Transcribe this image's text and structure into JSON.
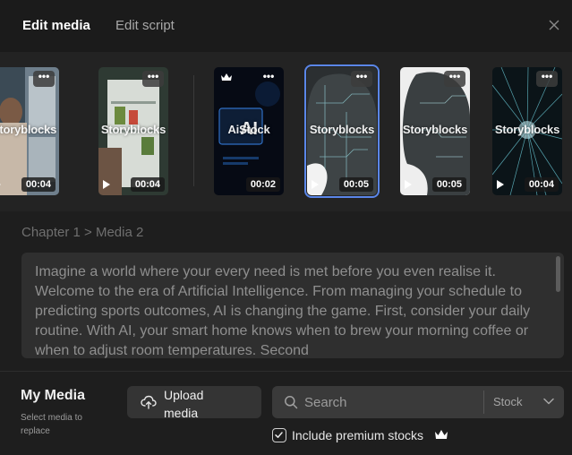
{
  "header": {
    "tabs": [
      {
        "label": "Edit media",
        "active": true
      },
      {
        "label": "Edit script",
        "active": false
      }
    ],
    "close_icon": "close-icon"
  },
  "media_strip": {
    "items": [
      {
        "watermark": "Storyblocks",
        "duration": "00:04",
        "premium": false,
        "selected": false
      },
      {
        "watermark": "Storyblocks",
        "duration": "00:04",
        "premium": false,
        "selected": false
      },
      {
        "watermark": "AiStock",
        "duration": "00:02",
        "premium": true,
        "selected": false,
        "badge_text": "AI"
      },
      {
        "watermark": "Storyblocks",
        "duration": "00:05",
        "premium": false,
        "selected": true
      },
      {
        "watermark": "Storyblocks",
        "duration": "00:05",
        "premium": false,
        "selected": false
      },
      {
        "watermark": "Storyblocks",
        "duration": "00:04",
        "premium": false,
        "selected": false
      }
    ],
    "menu_glyph": "•••"
  },
  "script": {
    "breadcrumb": "Chapter 1 > Media 2",
    "text": "Imagine a world where your every need is met before you even realise it. Welcome to the era of Artificial Intelligence. From managing your schedule to predicting sports outcomes, AI is changing the game. First, consider your daily routine. With AI, your smart home knows when to brew your morning coffee or when to adjust room temperatures. Second"
  },
  "bottom": {
    "title": "My Media",
    "hint": "Select media to replace",
    "upload_label": "Upload media",
    "search_placeholder": "Search",
    "stock_label": "Stock",
    "premium_label": "Include premium stocks",
    "premium_checked": true
  },
  "colors": {
    "accent_selected": "#5a86e8",
    "panel_bg": "#1e1e1e"
  }
}
